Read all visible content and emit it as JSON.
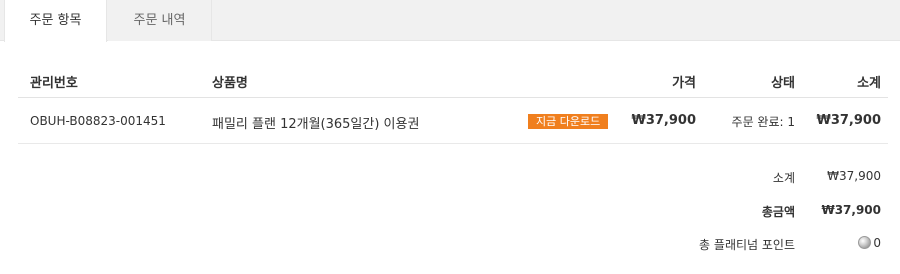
{
  "tabs": [
    {
      "label": "주문 항목",
      "active": true
    },
    {
      "label": "주문 내역",
      "active": false
    }
  ],
  "table": {
    "headers": {
      "id": "관리번호",
      "name": "상품명",
      "price": "가격",
      "status": "상태",
      "subtotal": "소계"
    },
    "rows": [
      {
        "id": "OBUH-B08823-001451",
        "name": "패밀리 플랜 12개월(365일간) 이용권",
        "download_label": "지금 다운로드",
        "price": "₩37,900",
        "status": "주문 완료: 1",
        "subtotal": "₩37,900"
      }
    ]
  },
  "summary": {
    "subtotal_label": "소계",
    "subtotal_value": "₩37,900",
    "total_label": "총금액",
    "total_value": "₩37,900",
    "points_label": "총 플래티넘 포인트",
    "points_value": "0",
    "points_icon": "platinum-coin-icon"
  },
  "colors": {
    "download_button": "#f07f1e",
    "tab_bar": "#f1f1f1"
  }
}
